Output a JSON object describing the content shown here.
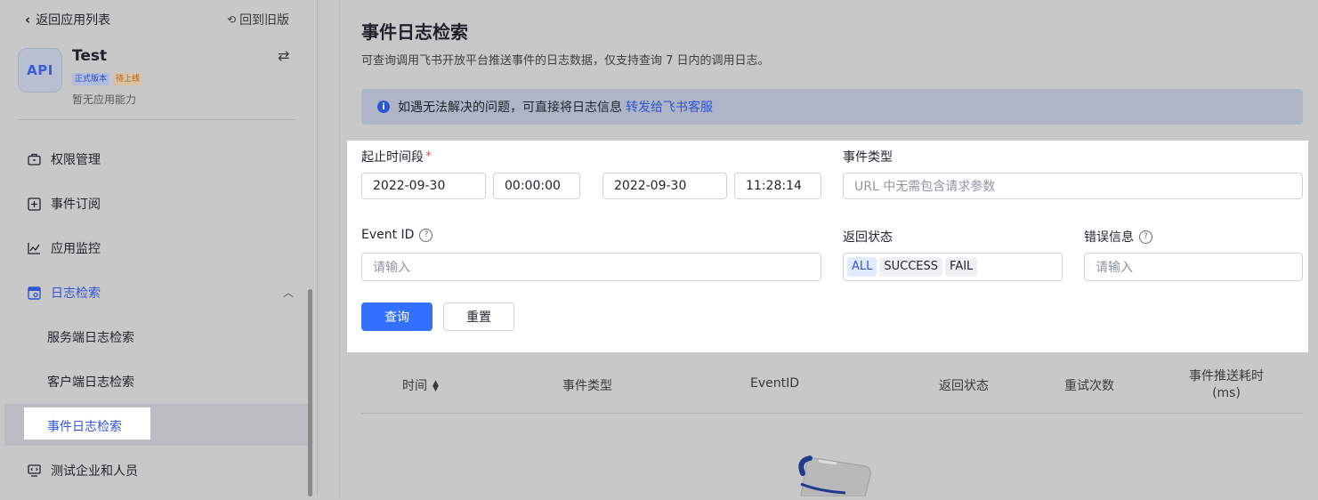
{
  "sidebar": {
    "back_label": "返回应用列表",
    "old_version_label": "回到旧版",
    "app": {
      "logo_text": "API",
      "name": "Test",
      "badges": [
        "正式版本",
        "待上线"
      ],
      "capability_text": "暂无应用能力"
    },
    "nav": {
      "permissions": "权限管理",
      "event_subscription": "事件订阅",
      "app_monitor": "应用监控",
      "log_search": "日志检索",
      "sub": {
        "server_log": "服务端日志检索",
        "client_log": "客户端日志检索",
        "event_log": "事件日志检索"
      },
      "test_org": "测试企业和人员"
    }
  },
  "main": {
    "title": "事件日志检索",
    "description": "可查询调用飞书开放平台推送事件的日志数据，仅支持查询 7 日内的调用日志。",
    "notice": {
      "text": "如遇无法解决的问题，可直接将日志信息",
      "link": "转发给飞书客服"
    },
    "form": {
      "time_range_label": "起止时间段",
      "start_date": "2022-09-30",
      "start_time": "00:00:00",
      "end_date": "2022-09-30",
      "end_time": "11:28:14",
      "event_type_label": "事件类型",
      "event_type_placeholder": "URL 中无需包含请求参数",
      "event_id_label": "Event ID",
      "event_id_placeholder": "请输入",
      "status_label": "返回状态",
      "status_options": [
        "ALL",
        "SUCCESS",
        "FAIL"
      ],
      "status_selected": "ALL",
      "error_label": "错误信息",
      "error_placeholder": "请输入",
      "query_button": "查询",
      "reset_button": "重置"
    },
    "table": {
      "columns": [
        "时间",
        "事件类型",
        "EventID",
        "返回状态",
        "重试次数",
        "事件推送耗时",
        "(ms)"
      ]
    }
  },
  "colors": {
    "accent": "#3370ff",
    "link": "#2f55d4",
    "required": "#f54a45"
  }
}
